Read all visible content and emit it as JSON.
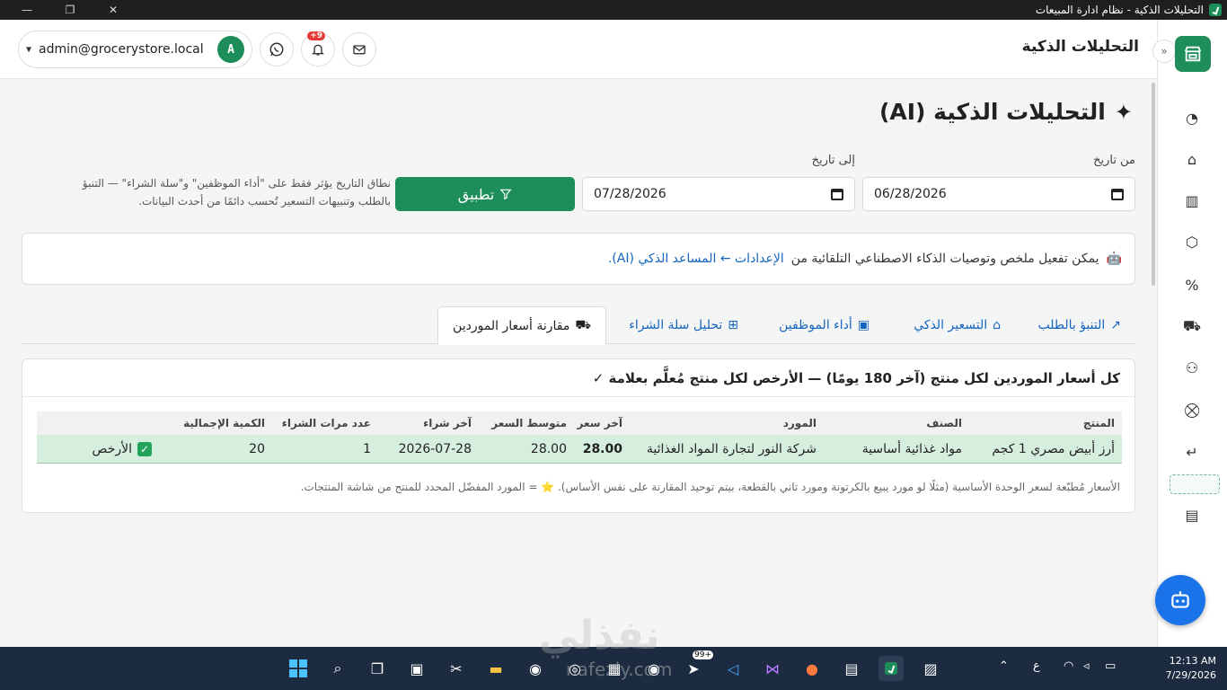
{
  "window": {
    "title": "التحليلات الذكية - نظام ادارة المبيعات",
    "minimize": "—",
    "restore": "❐",
    "close": "✕"
  },
  "header": {
    "title": "التحليلات الذكية",
    "user_email": "admin@grocerystore.local",
    "avatar_letter": "A",
    "notifications_badge": "+9"
  },
  "page": {
    "title": "التحليلات الذكية (AI)",
    "from_label": "من تاريخ",
    "to_label": "إلى تاريخ",
    "from_date": "06/28/2026",
    "to_date": "07/28/2026",
    "apply_label": "تطبيق",
    "hint_line1": "نطاق التاريخ يؤثر فقط على \"أداء الموظفين\" و\"سلة الشراء\" — التنبؤ",
    "hint_line2": "بالطلب وتنبيهات التسعير تُحسب دائمًا من أحدث البيانات.",
    "info_text": "يمكن تفعيل ملخص وتوصيات الذكاء الاصطناعي التلقائية من",
    "info_link": "الإعدادات ← المساعد الذكي (AI)."
  },
  "tabs": [
    {
      "label": "التنبؤ بالطلب",
      "icon": "chart-line-icon"
    },
    {
      "label": "التسعير الذكي",
      "icon": "tag-icon"
    },
    {
      "label": "أداء الموظفين",
      "icon": "badge-icon"
    },
    {
      "label": "تحليل سلة الشراء",
      "icon": "basket-icon"
    },
    {
      "label": "مقارنة أسعار الموردين",
      "icon": "truck-icon"
    }
  ],
  "card": {
    "heading": "كل أسعار الموردين لكل منتج (آخر 180 يومًا) — الأرخص لكل منتج مُعلَّم بعلامة ✓",
    "columns": [
      "المنتج",
      "الصنف",
      "المورد",
      "آخر سعر",
      "متوسط السعر",
      "آخر شراء",
      "عدد مرات الشراء",
      "الكمية الإجمالية",
      ""
    ],
    "rows": [
      {
        "product": "أرز أبيض مصري 1 كجم",
        "category": "مواد غذائية أساسية",
        "supplier": "شركة النور لتجارة المواد الغذائية",
        "last_price": "28.00",
        "avg_price": "28.00",
        "last_purchase": "2026-07-28",
        "purchase_count": "1",
        "total_qty": "20",
        "status": "الأرخص"
      }
    ],
    "footnote": "الأسعار مُطبّعة لسعر الوحدة الأساسية (مثلًا لو مورد يبيع بالكرتونة ومورد تاني بالقطعة، بيتم توحيد المقارنة على نفس الأساس). ⭐ = المورد المفضّل المحدد للمنتج من شاشة المنتجات."
  },
  "taskbar": {
    "time": "12:13 AM",
    "date": "7/29/2026",
    "tray_lang": "ع",
    "badge_99": "99+",
    "watermark": "نفذلي",
    "watermark_url": "nafezly.com"
  },
  "colors": {
    "primary": "#1d8e5a",
    "link": "#1565c0",
    "fab": "#1a73e8"
  }
}
